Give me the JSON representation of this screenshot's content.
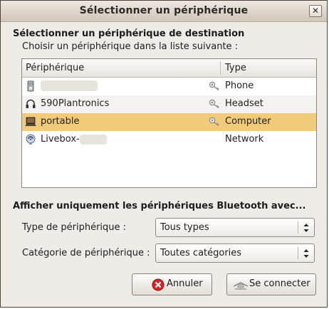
{
  "window": {
    "title": "Sélectionner un périphérique"
  },
  "main": {
    "heading": "Sélectionner un périphérique de destination",
    "instruction": "Choisir un périphérique dans la liste suivante :"
  },
  "device_list": {
    "columns": [
      "Périphérique",
      "Type"
    ],
    "rows": [
      {
        "name": "",
        "type": "Phone",
        "icon": "phone-icon",
        "paired": true,
        "selected": false
      },
      {
        "name": "590Plantronics",
        "type": "Headset",
        "icon": "headset-icon",
        "paired": true,
        "selected": false
      },
      {
        "name": "portable",
        "type": "Computer",
        "icon": "computer-icon",
        "paired": true,
        "selected": true
      },
      {
        "name": "Livebox-",
        "type": "Network",
        "icon": "network-icon",
        "paired": false,
        "selected": false
      }
    ]
  },
  "filter": {
    "heading": "Afficher uniquement les périphériques Bluetooth avec...",
    "type_label": "Type de périphérique :",
    "type_value": "Tous types",
    "category_label": "Catégorie de périphérique :",
    "category_value": "Toutes catégories"
  },
  "buttons": {
    "cancel": "Annuler",
    "connect": "Se connecter"
  },
  "colors": {
    "selection": "#f1cb79",
    "dialog_bg": "#efebe7"
  }
}
